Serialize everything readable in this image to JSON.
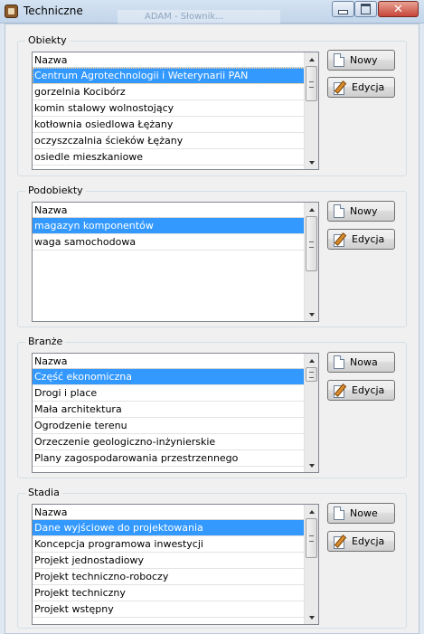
{
  "window": {
    "title": "Techniczne",
    "ghost_title": "ADAM - Słownik..."
  },
  "groups": {
    "obiekty": {
      "label": "Obiekty",
      "header": "Nazwa",
      "rows": [
        "Centrum Agrotechnologii i Weterynarii PAN",
        "gorzelnia Kocibórz",
        "komin stalowy wolnostojący",
        "kotłownia osiedlowa Łężany",
        "oczyszczalnia ścieków Łężany",
        "osiedle mieszkaniowe"
      ],
      "selected_index": 0,
      "new_label": "Nowy",
      "edit_label": "Edycja"
    },
    "podobiekty": {
      "label": "Podobiekty",
      "header": "Nazwa",
      "rows": [
        "magazyn komponentów",
        "waga samochodowa"
      ],
      "selected_index": 0,
      "new_label": "Nowy",
      "edit_label": "Edycja"
    },
    "branze": {
      "label": "Branże",
      "header": "Nazwa",
      "rows": [
        "Część ekonomiczna",
        "Drogi i place",
        "Mała architektura",
        "Ogrodzenie terenu",
        "Orzeczenie geologiczno-inżynierskie",
        "Plany zagospodarowania przestrzennego"
      ],
      "selected_index": 0,
      "new_label": "Nowa",
      "edit_label": "Edycja"
    },
    "stadia": {
      "label": "Stadia",
      "header": "Nazwa",
      "rows": [
        "Dane wyjściowe do projektowania",
        "Koncepcja programowa inwestycji",
        "Projekt jednostadiowy",
        "Projekt techniczno-roboczy",
        "Projekt techniczny",
        "Projekt wstępny"
      ],
      "selected_index": 0,
      "new_label": "Nowe",
      "edit_label": "Edycja"
    }
  },
  "colors": {
    "selection": "#3399ff",
    "window_bg": "#f0f0f0"
  }
}
